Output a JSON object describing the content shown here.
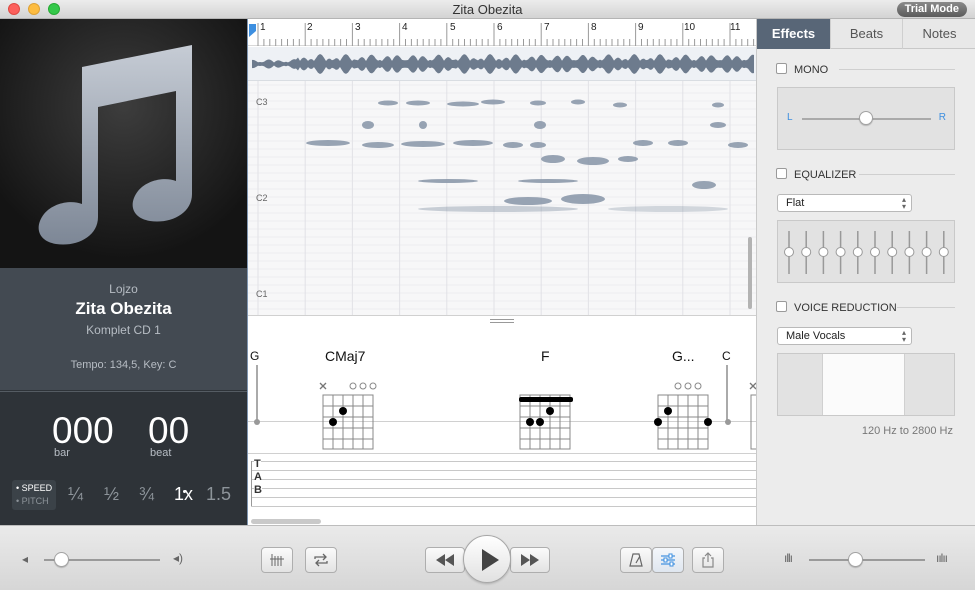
{
  "window": {
    "title": "Zita Obezita",
    "trial_badge": "Trial Mode"
  },
  "track": {
    "artist": "Lojzo",
    "title": "Zita Obezita",
    "album": "Komplet CD 1",
    "tempo_key": "Tempo: 134,5, Key: C"
  },
  "counter": {
    "bar_value": "000",
    "bar_label": "bar",
    "beat_value": "00",
    "beat_label": "beat"
  },
  "speed": {
    "speed_label": "SPEED",
    "pitch_label": "PITCH",
    "rates": [
      "¼",
      "½",
      "¾",
      "1x",
      "1.5"
    ],
    "active_rate": "1x"
  },
  "timeline": {
    "bars": [
      "1",
      "2",
      "3",
      "4",
      "5",
      "6",
      "7",
      "8",
      "9",
      "10",
      "11"
    ]
  },
  "spectrogram": {
    "notes": [
      "C3",
      "C2",
      "C1"
    ]
  },
  "chords": [
    {
      "name": "G"
    },
    {
      "name": "CMaj7"
    },
    {
      "name": "F"
    },
    {
      "name": "G..."
    },
    {
      "name": "C"
    }
  ],
  "tablature": {
    "letters": [
      "T",
      "A",
      "B"
    ]
  },
  "effects_panel": {
    "tabs": [
      "Effects",
      "Beats",
      "Notes"
    ],
    "active_tab": "Effects",
    "mono": {
      "label": "MONO",
      "checked": false,
      "left": "L",
      "right": "R",
      "pan": 0.5
    },
    "equalizer": {
      "label": "EQUALIZER",
      "checked": false,
      "preset": "Flat",
      "bands": 10
    },
    "voice_reduction": {
      "label": "VOICE REDUCTION",
      "checked": false,
      "preset": "Male Vocals",
      "range": "120 Hz to 2800 Hz"
    }
  },
  "transport": {
    "volume": 0.15,
    "rate_slider": 0.4
  },
  "icons": {
    "play": "play-icon",
    "rewind": "rewind-icon",
    "fast_forward": "fast-forward-icon",
    "loop": "loop-icon",
    "marker": "marker-icon",
    "metronome": "metronome-icon",
    "mixer": "mixer-icon",
    "share": "share-icon"
  },
  "colors": {
    "accent": "#586677",
    "sidebar": "#2e3338",
    "info": "#434a52"
  }
}
